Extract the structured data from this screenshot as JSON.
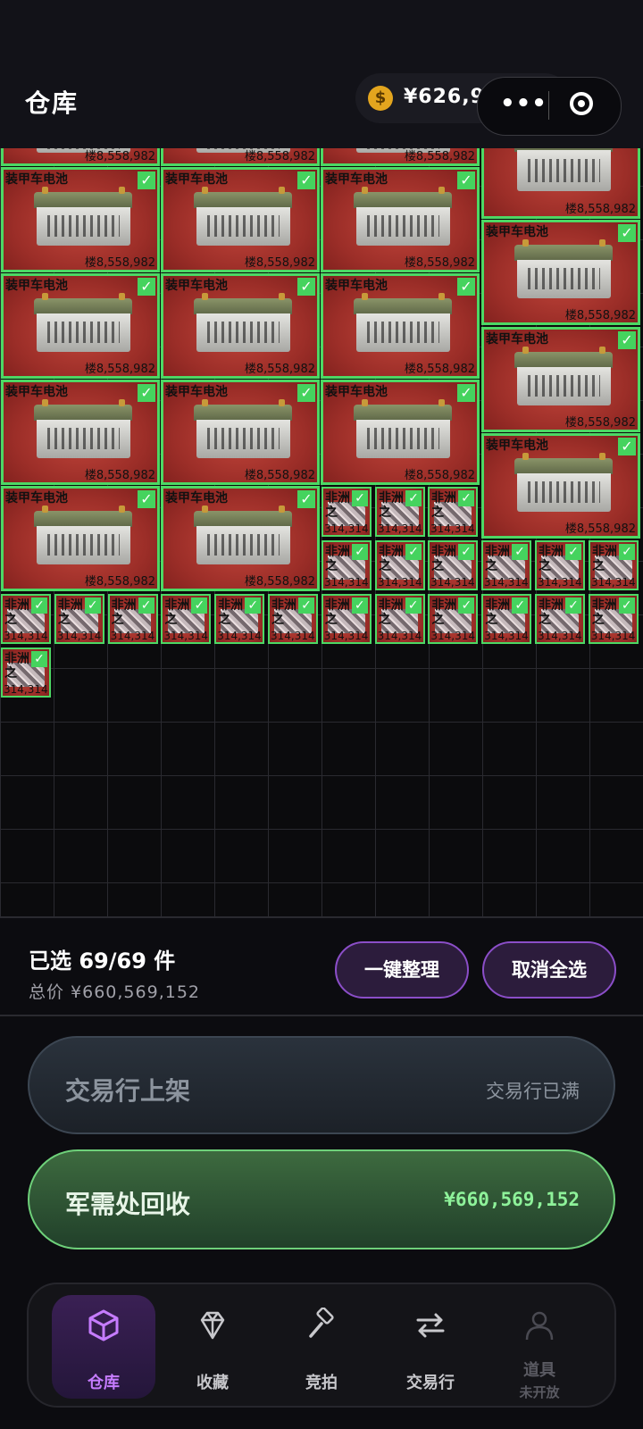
{
  "header": {
    "title": "仓库",
    "balance": "¥626,962,128",
    "coin_symbol": "$",
    "capsule_dots": "•••"
  },
  "items": {
    "large_name": "装甲车电池",
    "large_price": "楼8,558,982",
    "small_name": "非洲",
    "small_name2": "之",
    "small_price": "314,314",
    "check": "✓"
  },
  "selection": {
    "selected_text": "已选 69/69 件",
    "total_text": "总价 ¥660,569,152"
  },
  "buttons": {
    "organize": "一键整理",
    "deselect_all": "取消全选"
  },
  "market": {
    "label": "交易行上架",
    "status": "交易行已满"
  },
  "recycle": {
    "label": "军需处回收",
    "value": "¥660,569,152"
  },
  "nav": [
    {
      "label": "仓库",
      "icon": "box-icon"
    },
    {
      "label": "收藏",
      "icon": "diamond-icon"
    },
    {
      "label": "竞拍",
      "icon": "hammer-icon"
    },
    {
      "label": "交易行",
      "icon": "swap-icon"
    },
    {
      "label": "道具",
      "sublabel": "未开放",
      "icon": "person-icon"
    }
  ],
  "colors": {
    "selected_border": "#4cd864",
    "item_bg": "#9c2e28",
    "accent_purple": "#8b4ec8",
    "recycle_green": "#6ed17a"
  }
}
